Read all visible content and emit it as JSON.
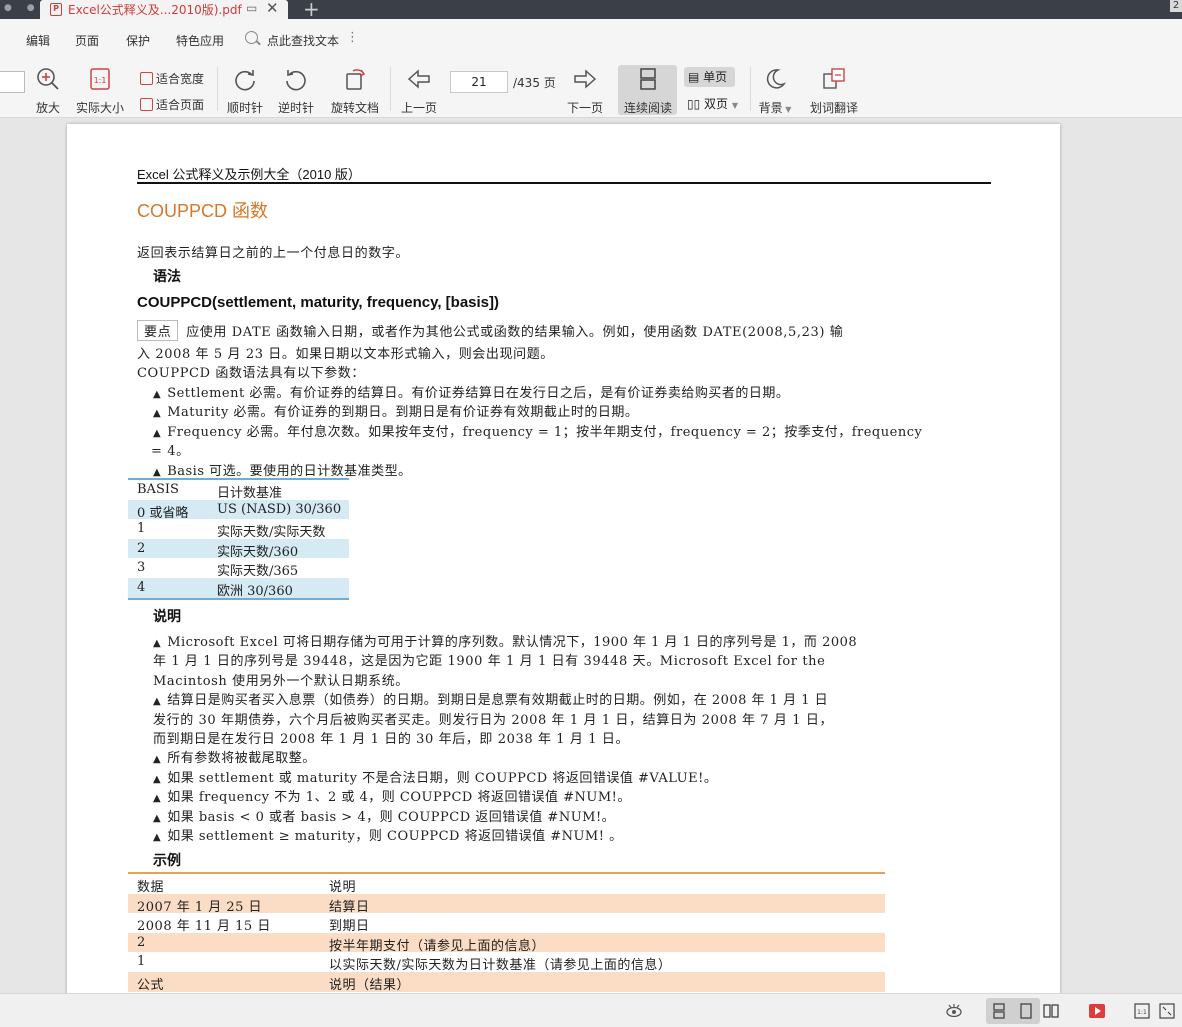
{
  "tab": {
    "title": "Excel公式释义及...2010版).pdf",
    "pdf_badge": "P"
  },
  "tabbar_number": "2",
  "menu": {
    "items": [
      "编辑",
      "页面",
      "保护",
      "特色应用"
    ],
    "search_label": "点此查找文本",
    "more": "⋮"
  },
  "toolbar": {
    "zoom_in": "放大",
    "actual_size": "实际大小",
    "actual_size_glyph": "1:1",
    "fit_width": "适合宽度",
    "fit_page": "适合页面",
    "rotate_cw": "顺时针",
    "rotate_ccw": "逆时针",
    "rotate_doc": "旋转文档",
    "prev_page": "上一页",
    "next_page": "下一页",
    "current_page": "21",
    "total_pages": "/435 页",
    "continuous": "连续阅读",
    "single": "单页",
    "double": "双页",
    "background": "背景",
    "translate": "划词翻译"
  },
  "doc": {
    "header": "Excel 公式释义及示例大全（2010 版）",
    "title": "COUPPCD  函数",
    "intro": "返回表示结算日之前的上一个付息日的数字。",
    "syntax_heading": "语法",
    "syntax": "COUPPCD(settlement, maturity, frequency, [basis])",
    "keypoint_label": "要点",
    "keypoint_line1": "应使用  DATE  函数输入日期，或者作为其他公式或函数的结果输入。例如，使用函数  DATE(2008,5,23)  输",
    "keypoint_line2": "入  2008  年  5  月  23  日。如果日期以文本形式输入，则会出现问题。",
    "params_intro": "COUPPCD  函数语法具有以下参数：",
    "params": [
      "Settlement    必需。有价证券的结算日。有价证券结算日在发行日之后，是有价证券卖给购买者的日期。",
      "Maturity    必需。有价证券的到期日。到期日是有价证券有效期截止时的日期。",
      "Frequency    必需。年付息次数。如果按年支付，frequency = 1；按半年期支付，frequency = 2；按季支付，frequency",
      "Basis    可选。要使用的日计数基准类型。"
    ],
    "param_wrap": "= 4。",
    "basis_table": {
      "headers": [
        "BASIS",
        "日计数基准"
      ],
      "rows": [
        [
          "0  或省略",
          "US (NASD) 30/360"
        ],
        [
          "1",
          "实际天数/实际天数"
        ],
        [
          "2",
          "实际天数/360"
        ],
        [
          "3",
          "实际天数/365"
        ],
        [
          "4",
          "欧洲  30/360"
        ]
      ]
    },
    "notes_heading": "说明",
    "notes_lines": [
      "Microsoft Excel  可将日期存储为可用于计算的序列数。默认情况下，1900  年  1  月  1  日的序列号是  1，而  2008",
      "年  1  月  1  日的序列号是  39448，这是因为它距  1900  年  1  月  1  日有  39448  天。Microsoft Excel for the",
      "Macintosh  使用另外一个默认日期系统。",
      "结算日是购买者买入息票（如债券）的日期。到期日是息票有效期截止时的日期。例如，在  2008  年  1  月  1  日",
      "发行的  30  年期债券，六个月后被购买者买走。则发行日为  2008  年  1  月  1  日，结算日为  2008  年  7  月  1  日，",
      "而到期日是在发行日  2008  年  1  月  1  日的  30  年后，即  2038  年  1  月  1  日。",
      "所有参数将被截尾取整。",
      "如果  settlement  或  maturity  不是合法日期，则  COUPPCD  将返回错误值  #VALUE!。",
      "如果  frequency  不为  1、2  或  4，则  COUPPCD  将返回错误值  #NUM!。",
      "如果  basis < 0  或者  basis > 4，则  COUPPCD  返回错误值  #NUM!。",
      "如果  settlement ≥ maturity，则  COUPPCD  将返回错误值  #NUM!  。"
    ],
    "example_heading": "示例",
    "example_table": {
      "headers": [
        "数据",
        "说明"
      ],
      "rows": [
        [
          "2007  年  1  月  25  日",
          "结算日"
        ],
        [
          "2008  年  11  月  15  日",
          "到期日"
        ],
        [
          "2",
          "按半年期支付（请参见上面的信息）"
        ],
        [
          "1",
          "以实际天数/实际天数为日计数基准（请参见上面的信息）"
        ],
        [
          "公式",
          "说明（结果）"
        ]
      ]
    }
  },
  "colors": {
    "title_orange": "#d7772a",
    "basis_blue": "#6aaedc",
    "basis_alt": "#d5eaf3",
    "example_orange": "#e8a060",
    "example_alt": "#fbdcc5"
  }
}
